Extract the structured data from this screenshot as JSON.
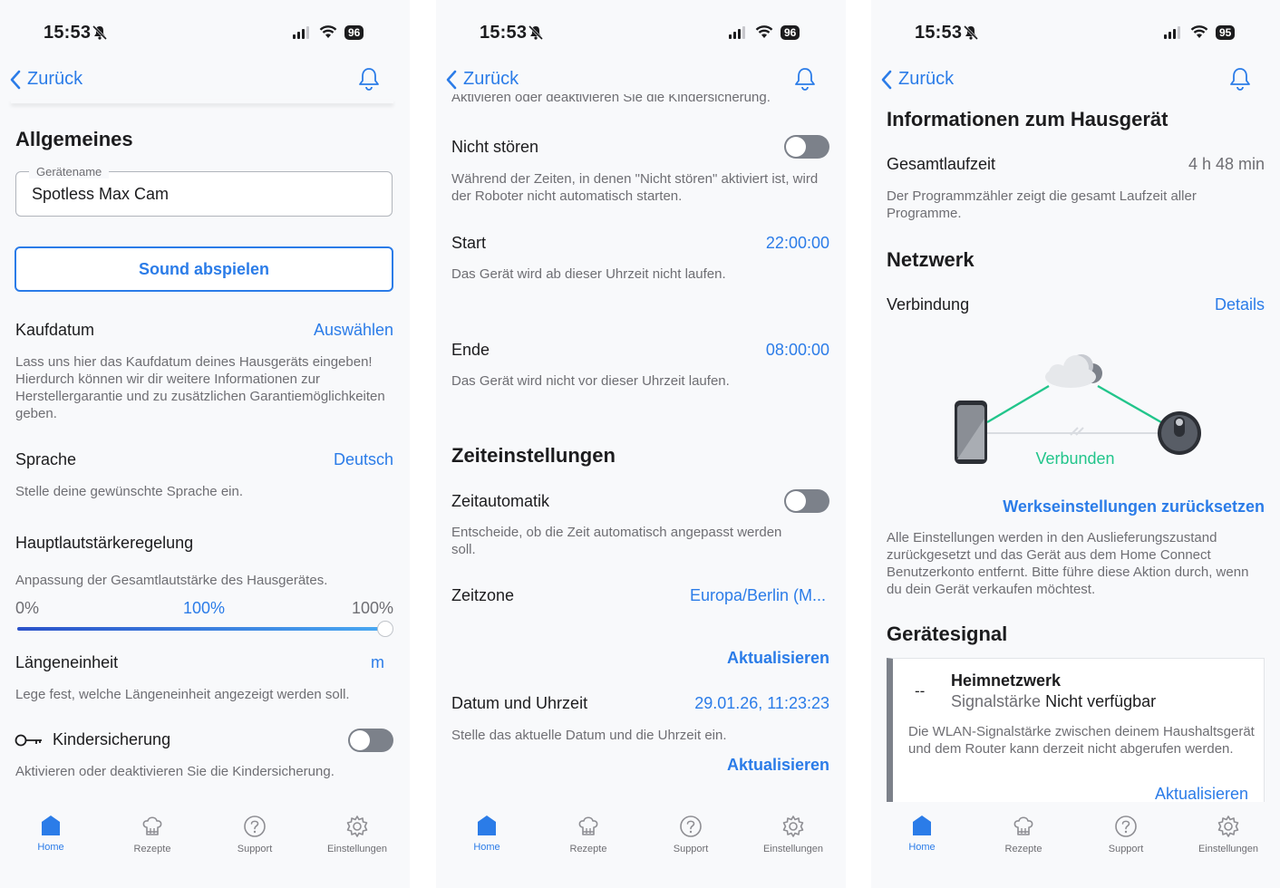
{
  "status_bar": [
    {
      "time": "15:53",
      "battery": "96"
    },
    {
      "time": "15:53",
      "battery": "96"
    },
    {
      "time": "15:53",
      "battery": "95"
    }
  ],
  "nav": {
    "back_label": "Zurück"
  },
  "screen1": {
    "section_title": "Allgemeines",
    "device_name_legend": "Gerätename",
    "device_name_value": "Spotless Max Cam",
    "play_sound_button": "Sound abspielen",
    "purchase_date": {
      "label": "Kaufdatum",
      "value": "Auswählen",
      "desc": "Lass uns hier das Kaufdatum deines Hausgeräts eingeben! Hierdurch können wir dir weitere Informationen zur Herstellergarantie und zu zusätzlichen Garantiemöglichkeiten geben."
    },
    "language": {
      "label": "Sprache",
      "value": "Deutsch",
      "desc": "Stelle deine gewünschte Sprache ein."
    },
    "volume": {
      "label": "Hauptlautstärkeregelung",
      "desc": "Anpassung der Gesamtlautstärke des Hausgerätes.",
      "min_label": "0%",
      "current_label": "100%",
      "max_label": "100%",
      "level": 1.0
    },
    "length_unit": {
      "label": "Längeneinheit",
      "value": "m",
      "desc": "Lege fest, welche Längeneinheit angezeigt werden soll."
    },
    "child_lock": {
      "label": "Kindersicherung",
      "desc": "Aktivieren oder deaktivieren Sie die Kindersicherung.",
      "enabled": false
    }
  },
  "screen2": {
    "cut_top_text": "Aktivieren oder deaktivieren Sie die Kindersicherung.",
    "dnd": {
      "label": "Nicht stören",
      "desc": "Während der Zeiten, in denen \"Nicht stören\" aktiviert ist, wird der Roboter nicht automatisch starten.",
      "enabled": false
    },
    "start": {
      "label": "Start",
      "value": "22:00:00",
      "desc": "Das Gerät wird ab dieser Uhrzeit nicht laufen."
    },
    "end": {
      "label": "Ende",
      "value": "08:00:00",
      "desc": "Das Gerät wird nicht vor dieser Uhrzeit laufen."
    },
    "section_title": "Zeiteinstellungen",
    "auto_time": {
      "label": "Zeitautomatik",
      "desc": "Entscheide, ob die Zeit automatisch angepasst werden soll.",
      "enabled": false
    },
    "timezone": {
      "label": "Zeitzone",
      "value": "Europa/Berlin (M..."
    },
    "update_1": "Aktualisieren",
    "datetime": {
      "label": "Datum und Uhrzeit",
      "value": "29.01.26, 11:23:23",
      "desc": "Stelle das aktuelle Datum und die Uhrzeit ein."
    },
    "update_2": "Aktualisieren"
  },
  "screen3": {
    "section_info": "Informationen zum Hausgerät",
    "runtime": {
      "label": "Gesamtlaufzeit",
      "value": "4 h 48 min",
      "desc": "Der Programmzähler zeigt die gesamt Laufzeit aller Programme."
    },
    "section_network": "Netzwerk",
    "connection": {
      "label": "Verbindung",
      "value": "Details"
    },
    "connected_label": "Verbunden",
    "factory_reset": {
      "label": "Werkseinstellungen zurücksetzen",
      "desc": "Alle Einstellungen werden in den Auslieferungszustand zurückgesetzt und das Gerät aus dem Home Connect Benutzerkonto entfernt. Bitte führe diese Aktion durch, wenn du dein Gerät verkaufen möchtest."
    },
    "section_signal": "Gerätesignal",
    "signal_card": {
      "dash": "--",
      "title": "Heimnetzwerk",
      "strength_label": "Signalstärke",
      "strength_value": "Nicht verfügbar",
      "desc": "Die WLAN-Signalstärke zwischen deinem Haushaltsgerät und dem Router kann derzeit nicht abgerufen werden.",
      "action": "Aktualisieren"
    }
  },
  "tabbar": [
    {
      "label": "Home",
      "icon": "home-icon",
      "active": true
    },
    {
      "label": "Rezepte",
      "icon": "chef-hat-icon",
      "active": false
    },
    {
      "label": "Support",
      "icon": "help-icon",
      "active": false
    },
    {
      "label": "Einstellungen",
      "icon": "gear-icon",
      "active": false
    }
  ],
  "colors": {
    "accent": "#2b7ce8",
    "connected": "#22c58b",
    "toggle_off": "#7c818a",
    "background": "#f8f9fb"
  }
}
